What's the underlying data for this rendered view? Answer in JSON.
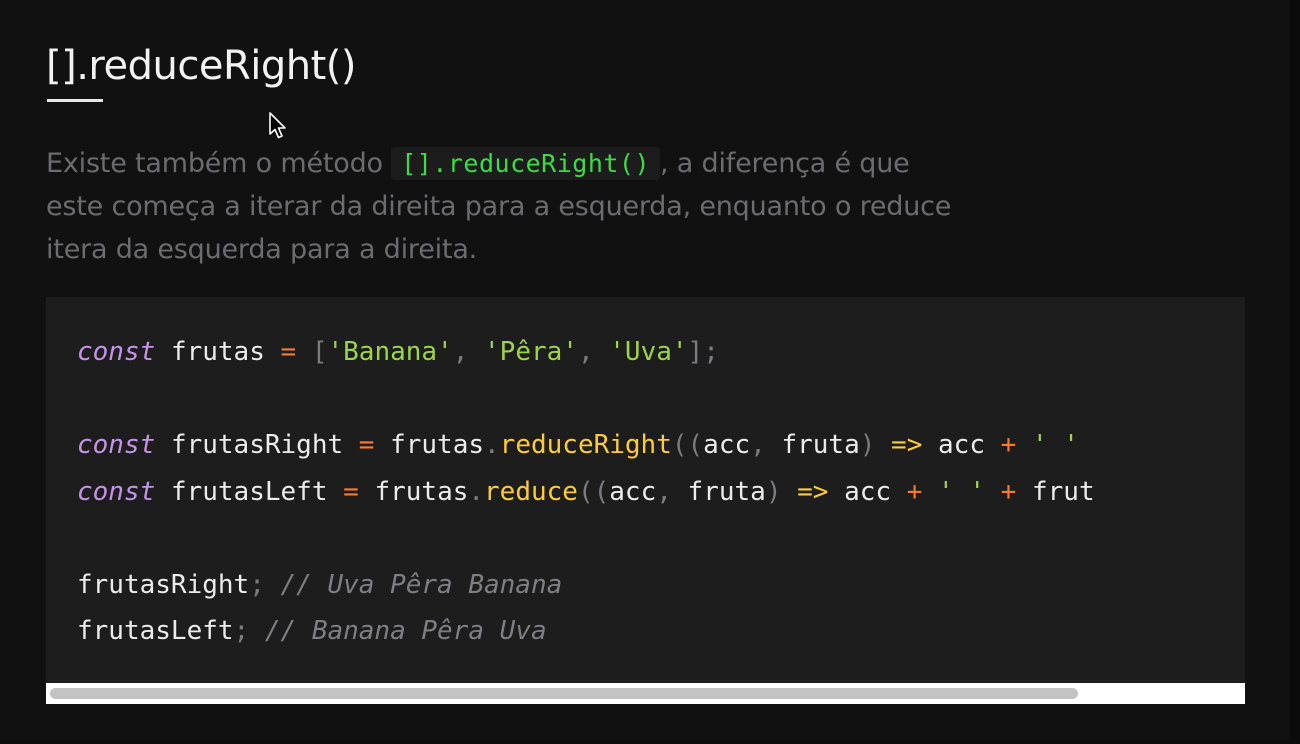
{
  "slide": {
    "title": "[].reduceRight()",
    "description": {
      "before": "Existe também o método ",
      "inline_code": "[].reduceRight()",
      "after_line1": ", a diferença é que",
      "line2": "este começa a iterar da direita para a esquerda, enquanto o reduce",
      "line3": "itera da esquerda para a direita."
    }
  },
  "code": {
    "line1": {
      "kw": "const",
      "name": "frutas",
      "eq": "=",
      "open": "[",
      "s1": "'Banana'",
      "c1": ",",
      "s2": "'Pêra'",
      "c2": ",",
      "s3": "'Uva'",
      "close": "];"
    },
    "line2": {
      "kw": "const",
      "name": "frutasRight",
      "eq": "=",
      "obj": "frutas",
      "dot": ".",
      "fn": "reduceRight",
      "p1": "((",
      "a1": "acc",
      "c1": ",",
      "a2": "fruta",
      "p2": ")",
      "arrow": "=>",
      "acc": "acc",
      "plus": "+",
      "str": "' '"
    },
    "line3": {
      "kw": "const",
      "name": "frutasLeft",
      "eq": "=",
      "obj": "frutas",
      "dot": ".",
      "fn": "reduce",
      "p1": "((",
      "a1": "acc",
      "c1": ",",
      "a2": "fruta",
      "p2": ")",
      "arrow": "=>",
      "acc": "acc",
      "plus1": "+",
      "str": "' '",
      "plus2": "+",
      "tail": "frut"
    },
    "line4": {
      "name": "frutasRight",
      "semi": ";",
      "comment": "// Uva Pêra Banana"
    },
    "line5": {
      "name": "frutasLeft",
      "semi": ";",
      "comment": "// Banana Pêra Uva"
    }
  },
  "icons": {
    "cursor": "mouse-pointer-icon"
  },
  "colors": {
    "keyword": "#c792ea",
    "string": "#9bd54a",
    "function": "#ffcb3b",
    "operator": "#ff7a2b",
    "comment": "#7e7e84",
    "inline_code": "#3ddc45"
  }
}
